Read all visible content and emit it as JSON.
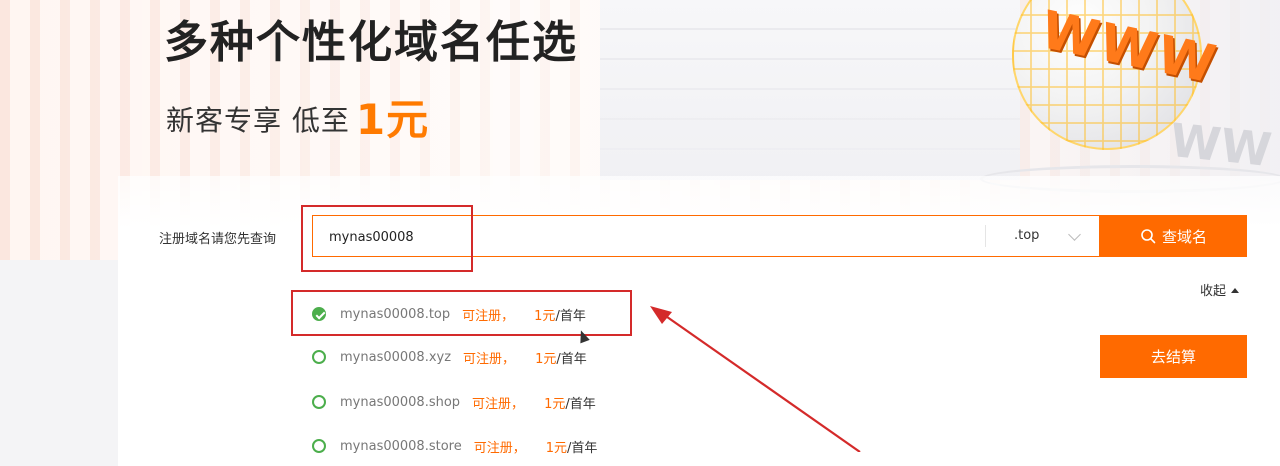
{
  "banner": {
    "title": "多种个性化域名任选",
    "subtitle": "新客专享 低至",
    "price_highlight": "1元",
    "globe_text": "WWW",
    "globe_text_shadow": "WW"
  },
  "search": {
    "label": "注册域名请您先查询",
    "query_value": "mynas00008",
    "tld_selected": ".top",
    "button_label": "查域名",
    "accent_color": "#ff6a00"
  },
  "results": {
    "collapse_label": "收起",
    "checkout_label": "去结算",
    "items": [
      {
        "domain": "mynas00008.top",
        "status": "可注册，",
        "price": "1元",
        "unit": "/首年",
        "selected": true
      },
      {
        "domain": "mynas00008.xyz",
        "status": "可注册，",
        "price": "1元",
        "unit": "/首年",
        "selected": false
      },
      {
        "domain": "mynas00008.shop",
        "status": "可注册，",
        "price": "1元",
        "unit": "/首年",
        "selected": false
      },
      {
        "domain": "mynas00008.store",
        "status": "可注册，",
        "price": "1元",
        "unit": "/首年",
        "selected": false
      }
    ]
  },
  "annotations": {
    "color": "#d42a2a"
  }
}
